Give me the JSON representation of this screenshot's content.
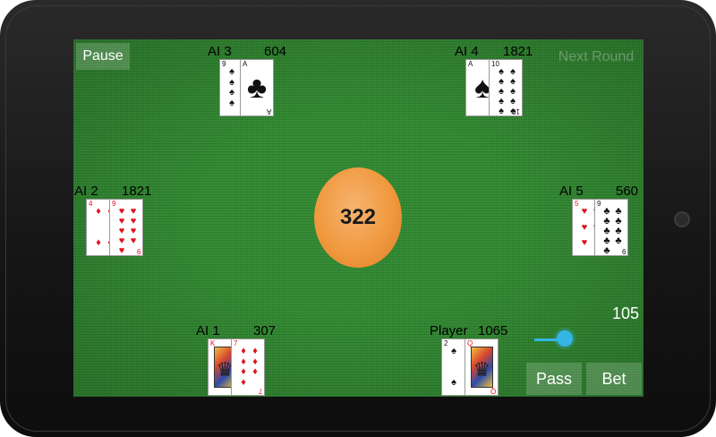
{
  "buttons": {
    "pause": "Pause",
    "next_round": "Next Round",
    "pass": "Pass",
    "bet": "Bet"
  },
  "pot": "322",
  "bet": {
    "amount": "105",
    "slider_fraction": 0.6
  },
  "players": {
    "ai3": {
      "name": "AI 3",
      "chips": "604"
    },
    "ai4": {
      "name": "AI 4",
      "chips": "1821"
    },
    "ai2": {
      "name": "AI 2",
      "chips": "1821"
    },
    "ai5": {
      "name": "AI 5",
      "chips": "560"
    },
    "ai1": {
      "name": "AI 1",
      "chips": "307"
    },
    "player": {
      "name": "Player",
      "chips": "1065"
    }
  },
  "cards": {
    "ai3": [
      {
        "rank": "9",
        "suit": "♠"
      },
      {
        "rank": "A",
        "suit": "♣"
      }
    ],
    "ai4": [
      {
        "rank": "A",
        "suit": "♠"
      },
      {
        "rank": "10",
        "suit": "♠"
      }
    ],
    "ai2": [
      {
        "rank": "4",
        "suit": "♦"
      },
      {
        "rank": "9",
        "suit": "♥"
      }
    ],
    "ai5": [
      {
        "rank": "5",
        "suit": "♥"
      },
      {
        "rank": "9",
        "suit": "♣"
      }
    ],
    "ai1": [
      {
        "rank": "K",
        "suit": "♦"
      },
      {
        "rank": "7",
        "suit": "♦"
      }
    ],
    "player": [
      {
        "rank": "2",
        "suit": "♠"
      },
      {
        "rank": "Q",
        "suit": "♦"
      }
    ]
  }
}
